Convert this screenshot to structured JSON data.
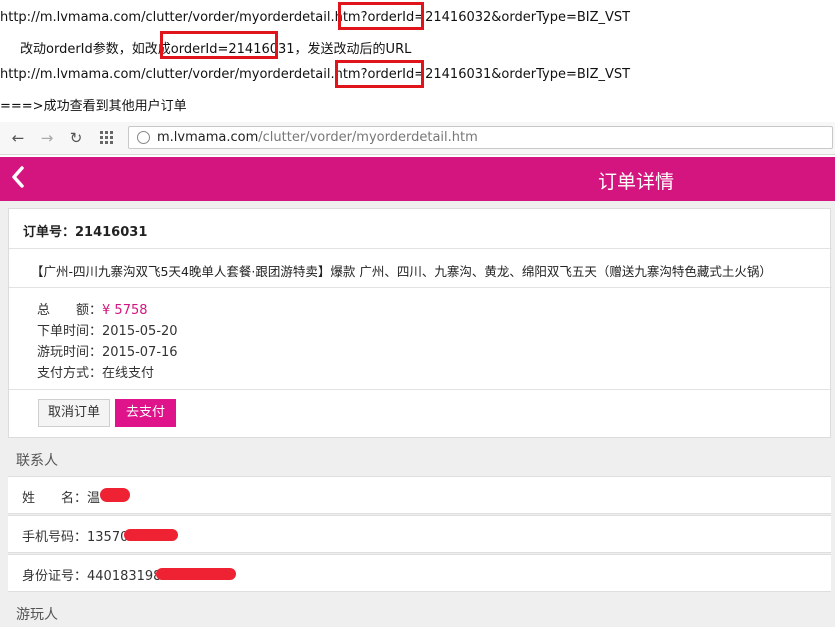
{
  "notes": {
    "url_original": "http://m.lvmama.com/clutter/vorder/myorderdetail.htm?orderId=21416032&orderType=BIZ_VST",
    "instruction": "改动orderId参数，如改成orderId=21416031，发送改动后的URL",
    "url_modified": "http://m.lvmama.com/clutter/vorder/myorderdetail.htm?orderId=21416031&orderType=BIZ_VST",
    "result": "===>成功查看到其他用户订单"
  },
  "browser": {
    "back_icon": "arrow-left-icon",
    "forward_icon": "arrow-right-icon",
    "reload_icon": "reload-icon",
    "apps_icon": "apps-grid-icon",
    "url_host": "m.lvmama.com",
    "url_path": "/clutter/vorder/myorderdetail.htm"
  },
  "app": {
    "title": "订单详情",
    "accent": "#d5157f"
  },
  "order": {
    "number_label": "订单号：21416031",
    "product": "【广州-四川九寨沟双飞5天4晚单人套餐·跟团游特卖】爆款 广州、四川、九寨沟、黄龙、绵阳双飞五天（赠送九寨沟特色藏式土火锅）",
    "amount_label": "总　　额：",
    "amount_value": "¥ 5758",
    "order_time": "下单时间：2015-05-20",
    "travel_time": "游玩时间：2015-07-16",
    "pay_method": "支付方式：在线支付",
    "cancel_button": "取消订单",
    "pay_button": "去支付"
  },
  "contact": {
    "section_title": "联系人",
    "name_label": "姓　　名：温",
    "phone_label": "手机号码：13570",
    "id_label": "身份证号：440183198"
  },
  "traveler": {
    "section_title": "游玩人"
  }
}
